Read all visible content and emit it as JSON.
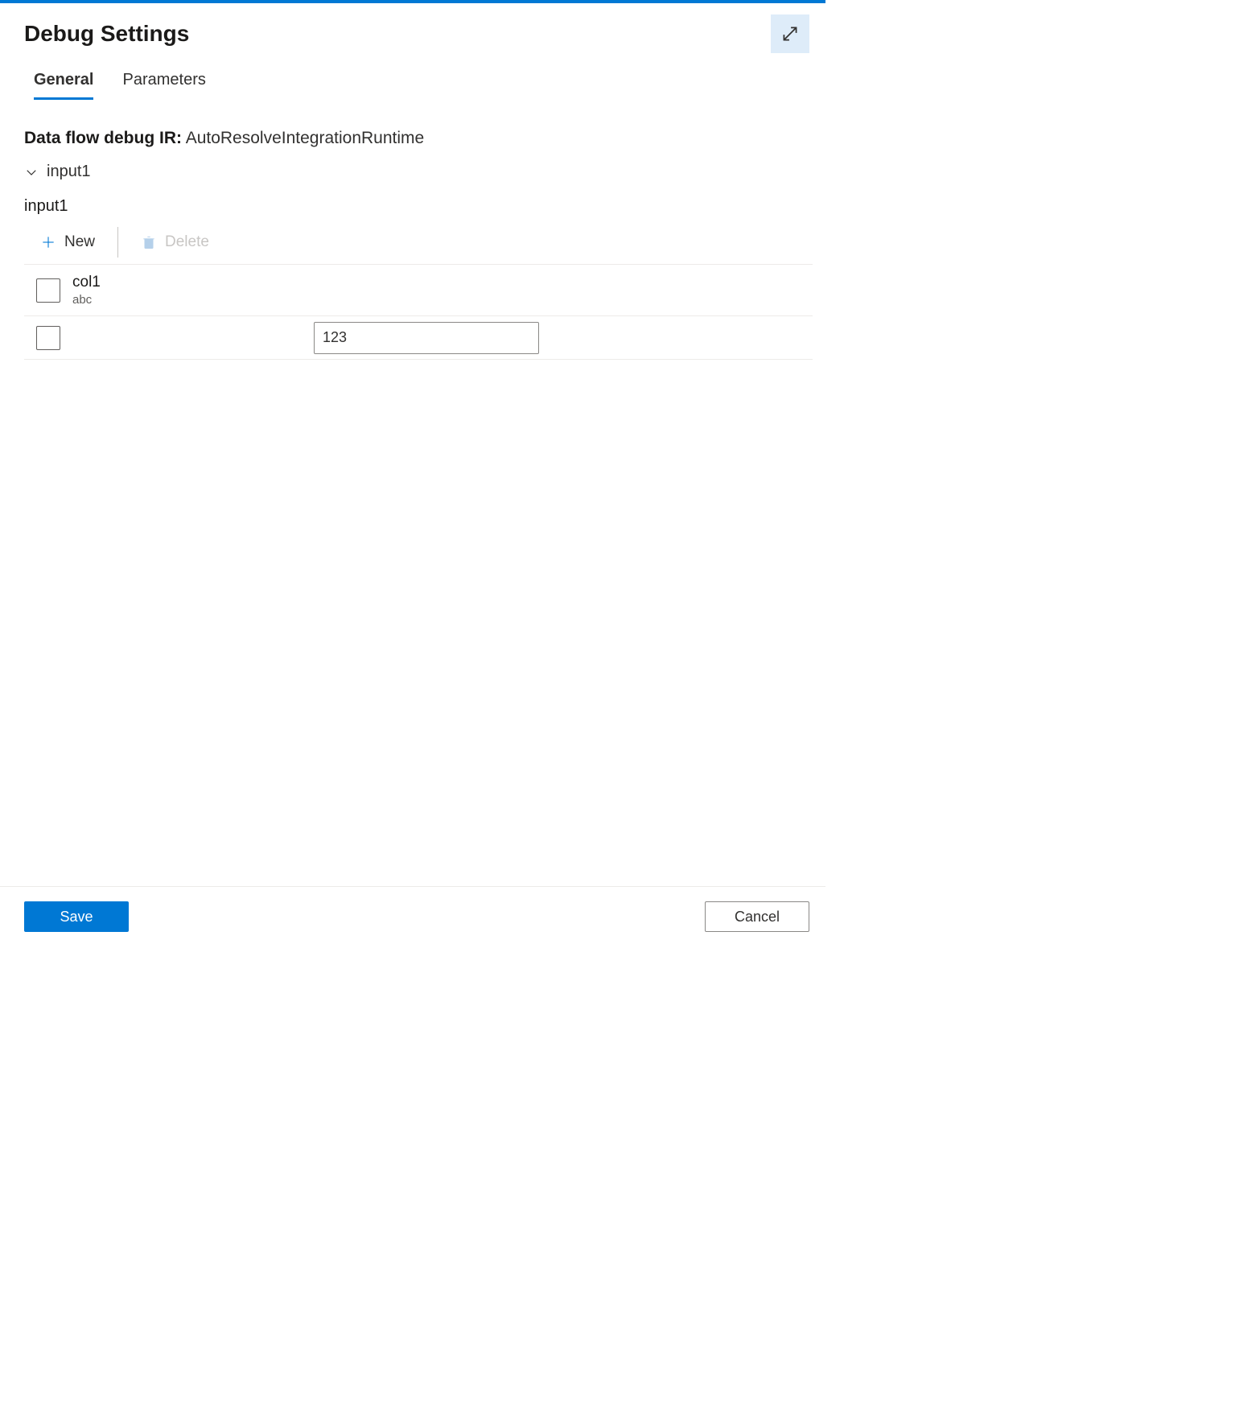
{
  "header": {
    "title": "Debug Settings"
  },
  "tabs": [
    {
      "label": "General",
      "active": true
    },
    {
      "label": "Parameters",
      "active": false
    }
  ],
  "ir": {
    "label": "Data flow debug IR:",
    "value": "AutoResolveIntegrationRuntime"
  },
  "section": {
    "name": "input1",
    "sub_heading": "input1"
  },
  "toolbar": {
    "new_label": "New",
    "delete_label": "Delete"
  },
  "table": {
    "header": {
      "col_name": "col1",
      "col_sample": "abc"
    },
    "row": {
      "value": "123"
    }
  },
  "footer": {
    "save_label": "Save",
    "cancel_label": "Cancel"
  }
}
